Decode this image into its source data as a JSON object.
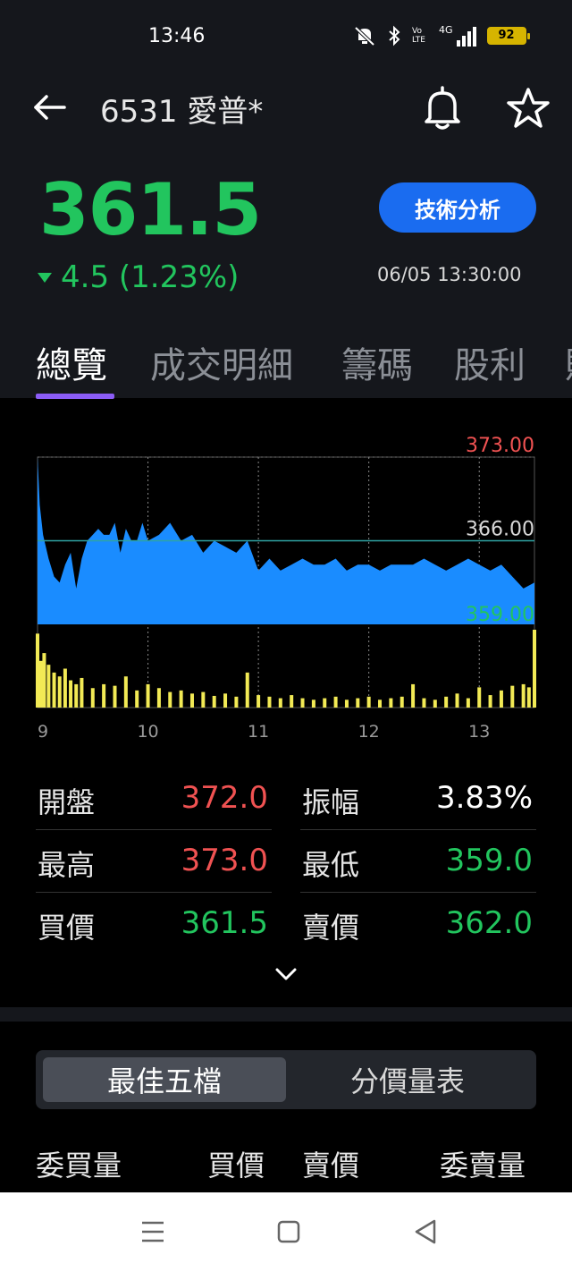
{
  "status_bar": {
    "time": "13:46",
    "icons": [
      "mute-icon",
      "bluetooth-icon",
      "volte-icon",
      "4g-signal-icon"
    ],
    "volte": "Vo LTE",
    "network": "4G",
    "battery": "92"
  },
  "header": {
    "back": "back-arrow-icon",
    "stock_name": "6531 愛普*",
    "bell": "bell-icon",
    "star": "star-icon"
  },
  "quote": {
    "price": "361.5",
    "change": "4.5 (1.23%)",
    "tech_button": "技術分析",
    "timestamp": "06/05 13:30:00",
    "colors": {
      "down": "#22c55e",
      "up": "#f05252",
      "accent": "#1a6cf0"
    }
  },
  "tabs": [
    {
      "label": "總覽"
    },
    {
      "label": "成交明細"
    },
    {
      "label": "籌碼"
    },
    {
      "label": "股利"
    },
    {
      "label": "財"
    }
  ],
  "chart_data": {
    "type": "area",
    "y_labels": {
      "high": "373.00",
      "ref": "366.00",
      "low": "359.00"
    },
    "ylim": [
      359,
      373
    ],
    "reference": 366,
    "x_ticks": [
      "9",
      "10",
      "11",
      "12",
      "13"
    ],
    "x_tick_hours": [
      9,
      10,
      11,
      12,
      13
    ],
    "x_range_hours": [
      9,
      13.5
    ],
    "price_series": {
      "x": [
        9.0,
        9.02,
        9.05,
        9.1,
        9.15,
        9.2,
        9.25,
        9.3,
        9.35,
        9.4,
        9.45,
        9.5,
        9.55,
        9.6,
        9.65,
        9.7,
        9.75,
        9.8,
        9.85,
        9.9,
        9.95,
        10.0,
        10.1,
        10.2,
        10.3,
        10.4,
        10.5,
        10.6,
        10.7,
        10.8,
        10.9,
        11.0,
        11.1,
        11.2,
        11.3,
        11.4,
        11.5,
        11.6,
        11.7,
        11.8,
        11.9,
        12.0,
        12.1,
        12.2,
        12.3,
        12.4,
        12.5,
        12.6,
        12.7,
        12.8,
        12.9,
        13.0,
        13.1,
        13.2,
        13.3,
        13.4,
        13.5
      ],
      "y": [
        373.0,
        369.0,
        366.5,
        364.5,
        363.0,
        362.5,
        364.0,
        365.0,
        362.0,
        364.5,
        366.0,
        366.5,
        367.0,
        366.5,
        366.5,
        367.5,
        365.0,
        367.0,
        366.0,
        366.0,
        367.5,
        366.0,
        366.5,
        367.5,
        366.0,
        366.5,
        365.0,
        366.0,
        365.5,
        365.0,
        366.0,
        363.5,
        364.5,
        363.5,
        364.0,
        364.5,
        364.0,
        364.0,
        364.5,
        363.5,
        364.0,
        364.0,
        363.5,
        364.0,
        364.0,
        364.0,
        364.5,
        364.0,
        363.5,
        364.0,
        364.5,
        364.0,
        363.5,
        364.0,
        363.0,
        362.0,
        362.5
      ]
    },
    "volume_series": {
      "x": [
        9.0,
        9.03,
        9.06,
        9.1,
        9.15,
        9.2,
        9.25,
        9.3,
        9.35,
        9.4,
        9.5,
        9.6,
        9.7,
        9.8,
        9.9,
        10.0,
        10.1,
        10.2,
        10.3,
        10.4,
        10.5,
        10.6,
        10.7,
        10.8,
        10.9,
        11.0,
        11.1,
        11.2,
        11.3,
        11.4,
        11.5,
        11.6,
        11.7,
        11.8,
        11.9,
        12.0,
        12.1,
        12.2,
        12.3,
        12.4,
        12.5,
        12.6,
        12.7,
        12.8,
        12.9,
        13.0,
        13.1,
        13.2,
        13.3,
        13.4,
        13.45,
        13.5
      ],
      "values": [
        95,
        60,
        70,
        55,
        45,
        40,
        50,
        35,
        30,
        38,
        25,
        30,
        28,
        40,
        22,
        30,
        25,
        20,
        22,
        18,
        20,
        15,
        18,
        14,
        45,
        16,
        14,
        12,
        16,
        12,
        10,
        12,
        14,
        10,
        12,
        14,
        10,
        12,
        14,
        30,
        12,
        10,
        14,
        18,
        12,
        26,
        16,
        22,
        28,
        30,
        26,
        100
      ]
    },
    "colors": {
      "area": "#1a8cff",
      "volume": "#f2ea55",
      "ref_line": "#2fa3a3",
      "high": "#f05252",
      "low": "#22c55e",
      "mid": "#d8d8d8"
    }
  },
  "stats": [
    {
      "label": "開盤",
      "value": "372.0",
      "color": "red"
    },
    {
      "label": "振幅",
      "value": "3.83%",
      "color": "white"
    },
    {
      "label": "最高",
      "value": "373.0",
      "color": "red"
    },
    {
      "label": "最低",
      "value": "359.0",
      "color": "green"
    },
    {
      "label": "買價",
      "value": "361.5",
      "color": "green"
    },
    {
      "label": "賣價",
      "value": "362.0",
      "color": "green"
    }
  ],
  "segments": [
    {
      "label": "最佳五檔"
    },
    {
      "label": "分價量表"
    }
  ],
  "orderbook_headers": [
    "委買量",
    "買價",
    "賣價",
    "委賣量"
  ],
  "nav": {
    "menu": "menu-icon",
    "home": "home-square-icon",
    "back": "back-triangle-icon"
  }
}
